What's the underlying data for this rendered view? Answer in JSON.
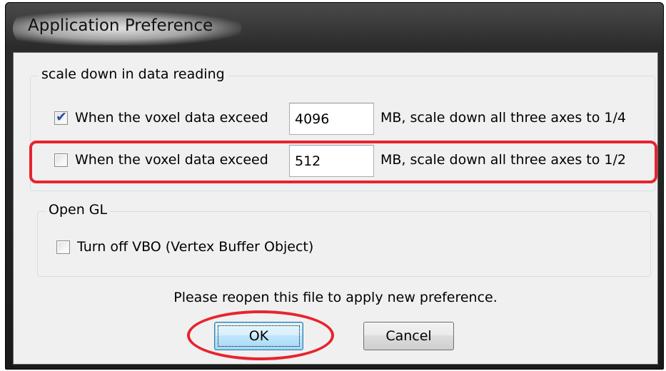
{
  "window": {
    "title": "Application Preference"
  },
  "scale_group": {
    "legend": "scale down in data reading",
    "rows": [
      {
        "checked": true,
        "prefix_label": "When the voxel data exceed",
        "value": "4096",
        "suffix_label": "MB, scale down all three axes to 1/4"
      },
      {
        "checked": false,
        "prefix_label": "When the voxel data exceed",
        "value": "512",
        "suffix_label": "MB, scale down all three axes to 1/2"
      }
    ]
  },
  "opengl_group": {
    "legend": "Open GL",
    "vbo_checked": false,
    "vbo_label": "Turn off VBO (Vertex Buffer Object)"
  },
  "message": "Please reopen this file to apply new preference.",
  "buttons": {
    "ok_label": "OK",
    "cancel_label": "Cancel"
  },
  "annotations": {
    "highlight_color": "#e8232f"
  },
  "icons": {
    "checkmark": "checkmark-icon"
  }
}
